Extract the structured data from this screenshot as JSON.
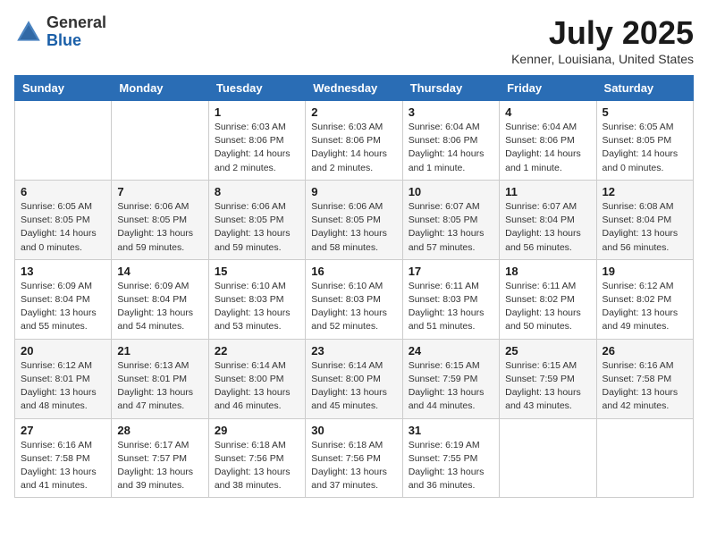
{
  "header": {
    "logo_general": "General",
    "logo_blue": "Blue",
    "title": "July 2025",
    "location": "Kenner, Louisiana, United States"
  },
  "weekdays": [
    "Sunday",
    "Monday",
    "Tuesday",
    "Wednesday",
    "Thursday",
    "Friday",
    "Saturday"
  ],
  "weeks": [
    [
      {
        "day": "",
        "info": ""
      },
      {
        "day": "",
        "info": ""
      },
      {
        "day": "1",
        "info": "Sunrise: 6:03 AM\nSunset: 8:06 PM\nDaylight: 14 hours and 2 minutes."
      },
      {
        "day": "2",
        "info": "Sunrise: 6:03 AM\nSunset: 8:06 PM\nDaylight: 14 hours and 2 minutes."
      },
      {
        "day": "3",
        "info": "Sunrise: 6:04 AM\nSunset: 8:06 PM\nDaylight: 14 hours and 1 minute."
      },
      {
        "day": "4",
        "info": "Sunrise: 6:04 AM\nSunset: 8:06 PM\nDaylight: 14 hours and 1 minute."
      },
      {
        "day": "5",
        "info": "Sunrise: 6:05 AM\nSunset: 8:05 PM\nDaylight: 14 hours and 0 minutes."
      }
    ],
    [
      {
        "day": "6",
        "info": "Sunrise: 6:05 AM\nSunset: 8:05 PM\nDaylight: 14 hours and 0 minutes."
      },
      {
        "day": "7",
        "info": "Sunrise: 6:06 AM\nSunset: 8:05 PM\nDaylight: 13 hours and 59 minutes."
      },
      {
        "day": "8",
        "info": "Sunrise: 6:06 AM\nSunset: 8:05 PM\nDaylight: 13 hours and 59 minutes."
      },
      {
        "day": "9",
        "info": "Sunrise: 6:06 AM\nSunset: 8:05 PM\nDaylight: 13 hours and 58 minutes."
      },
      {
        "day": "10",
        "info": "Sunrise: 6:07 AM\nSunset: 8:05 PM\nDaylight: 13 hours and 57 minutes."
      },
      {
        "day": "11",
        "info": "Sunrise: 6:07 AM\nSunset: 8:04 PM\nDaylight: 13 hours and 56 minutes."
      },
      {
        "day": "12",
        "info": "Sunrise: 6:08 AM\nSunset: 8:04 PM\nDaylight: 13 hours and 56 minutes."
      }
    ],
    [
      {
        "day": "13",
        "info": "Sunrise: 6:09 AM\nSunset: 8:04 PM\nDaylight: 13 hours and 55 minutes."
      },
      {
        "day": "14",
        "info": "Sunrise: 6:09 AM\nSunset: 8:04 PM\nDaylight: 13 hours and 54 minutes."
      },
      {
        "day": "15",
        "info": "Sunrise: 6:10 AM\nSunset: 8:03 PM\nDaylight: 13 hours and 53 minutes."
      },
      {
        "day": "16",
        "info": "Sunrise: 6:10 AM\nSunset: 8:03 PM\nDaylight: 13 hours and 52 minutes."
      },
      {
        "day": "17",
        "info": "Sunrise: 6:11 AM\nSunset: 8:03 PM\nDaylight: 13 hours and 51 minutes."
      },
      {
        "day": "18",
        "info": "Sunrise: 6:11 AM\nSunset: 8:02 PM\nDaylight: 13 hours and 50 minutes."
      },
      {
        "day": "19",
        "info": "Sunrise: 6:12 AM\nSunset: 8:02 PM\nDaylight: 13 hours and 49 minutes."
      }
    ],
    [
      {
        "day": "20",
        "info": "Sunrise: 6:12 AM\nSunset: 8:01 PM\nDaylight: 13 hours and 48 minutes."
      },
      {
        "day": "21",
        "info": "Sunrise: 6:13 AM\nSunset: 8:01 PM\nDaylight: 13 hours and 47 minutes."
      },
      {
        "day": "22",
        "info": "Sunrise: 6:14 AM\nSunset: 8:00 PM\nDaylight: 13 hours and 46 minutes."
      },
      {
        "day": "23",
        "info": "Sunrise: 6:14 AM\nSunset: 8:00 PM\nDaylight: 13 hours and 45 minutes."
      },
      {
        "day": "24",
        "info": "Sunrise: 6:15 AM\nSunset: 7:59 PM\nDaylight: 13 hours and 44 minutes."
      },
      {
        "day": "25",
        "info": "Sunrise: 6:15 AM\nSunset: 7:59 PM\nDaylight: 13 hours and 43 minutes."
      },
      {
        "day": "26",
        "info": "Sunrise: 6:16 AM\nSunset: 7:58 PM\nDaylight: 13 hours and 42 minutes."
      }
    ],
    [
      {
        "day": "27",
        "info": "Sunrise: 6:16 AM\nSunset: 7:58 PM\nDaylight: 13 hours and 41 minutes."
      },
      {
        "day": "28",
        "info": "Sunrise: 6:17 AM\nSunset: 7:57 PM\nDaylight: 13 hours and 39 minutes."
      },
      {
        "day": "29",
        "info": "Sunrise: 6:18 AM\nSunset: 7:56 PM\nDaylight: 13 hours and 38 minutes."
      },
      {
        "day": "30",
        "info": "Sunrise: 6:18 AM\nSunset: 7:56 PM\nDaylight: 13 hours and 37 minutes."
      },
      {
        "day": "31",
        "info": "Sunrise: 6:19 AM\nSunset: 7:55 PM\nDaylight: 13 hours and 36 minutes."
      },
      {
        "day": "",
        "info": ""
      },
      {
        "day": "",
        "info": ""
      }
    ]
  ]
}
